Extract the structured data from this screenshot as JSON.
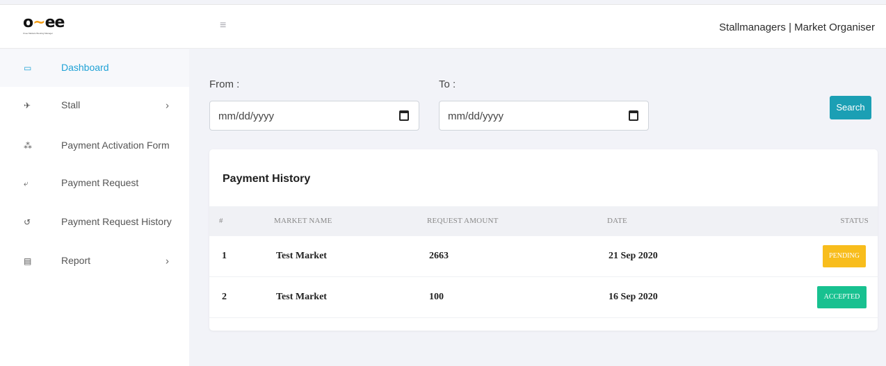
{
  "header": {
    "logo_main_left": "o",
    "logo_main_accent": "~",
    "logo_main_right": "ee",
    "logo_sub": "Oxee Markets Booking Manager",
    "user_text": "Stallmanagers | Market Organiser",
    "menu_icon": "hamburger-icon"
  },
  "sidebar": {
    "items": [
      {
        "label": "Dashboard",
        "icon": "laptop-icon",
        "glyph": "▭",
        "active": true
      },
      {
        "label": "Stall",
        "icon": "bullhorn-icon",
        "glyph": "✈",
        "chevron": "›"
      },
      {
        "label": "Payment Activation Form",
        "icon": "cubes-icon",
        "glyph": "⁂"
      },
      {
        "label": "Payment Request",
        "icon": "reply-all-icon",
        "glyph": "⤶"
      },
      {
        "label": "Payment Request History",
        "icon": "history-icon",
        "glyph": "↺"
      },
      {
        "label": "Report",
        "icon": "file-icon",
        "glyph": "▤",
        "chevron": "›"
      }
    ]
  },
  "filters": {
    "from_label": "From :",
    "to_label": "To :",
    "from_placeholder": "mm/dd/yyyy",
    "to_placeholder": "mm/dd/yyyy",
    "search_label": "Search"
  },
  "payment_history": {
    "title": "Payment History",
    "columns": [
      "#",
      "MARKET NAME",
      "REQUEST AMOUNT",
      "DATE",
      "STATUS"
    ],
    "rows": [
      {
        "num": "1",
        "market": "Test Market",
        "amount": "2663",
        "date": "21 Sep 2020",
        "status": "PENDING"
      },
      {
        "num": "2",
        "market": "Test Market",
        "amount": "100",
        "date": "16 Sep 2020",
        "status": "ACCEPTED"
      }
    ]
  },
  "colors": {
    "accent": "#1fa2d6",
    "search_button": "#1b9fb4",
    "pending": "#f8bd1c",
    "accepted": "#18c190"
  }
}
